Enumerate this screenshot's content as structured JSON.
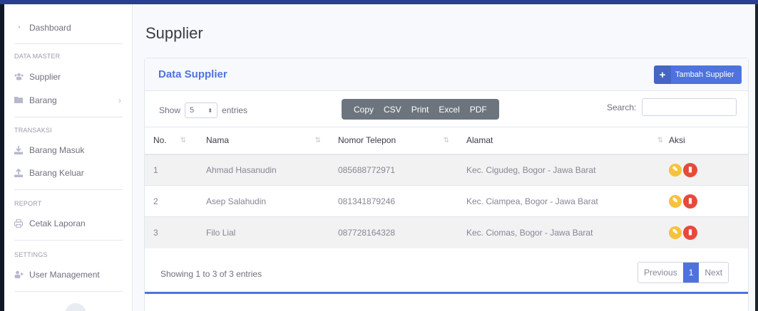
{
  "sidebar": {
    "dashboard": "Dashboard",
    "heading_master": "DATA MASTER",
    "supplier": "Supplier",
    "barang": "Barang",
    "heading_transaksi": "TRANSAKSI",
    "barang_masuk": "Barang Masuk",
    "barang_keluar": "Barang Keluar",
    "heading_report": "REPORT",
    "cetak_laporan": "Cetak Laporan",
    "heading_settings": "SETTINGS",
    "user_management": "User Management"
  },
  "page": {
    "title": "Supplier"
  },
  "card": {
    "title": "Data Supplier",
    "add_button": "Tambah Supplier"
  },
  "table_controls": {
    "show_label": "Show",
    "entries_value": "5",
    "entries_label": "entries",
    "buttons": [
      "Copy",
      "CSV",
      "Print",
      "Excel",
      "PDF"
    ],
    "search_label": "Search:",
    "search_value": ""
  },
  "table": {
    "headers": [
      "No.",
      "Nama",
      "Nomor Telepon",
      "Alamat",
      "Aksi"
    ],
    "rows": [
      {
        "no": "1",
        "nama": "Ahmad Hasanudin",
        "telepon": "085688772971",
        "alamat": "Kec. Cigudeg, Bogor - Jawa Barat"
      },
      {
        "no": "2",
        "nama": "Asep Salahudin",
        "telepon": "081341879246",
        "alamat": "Kec. Ciampea, Bogor - Jawa Barat"
      },
      {
        "no": "3",
        "nama": "Filo Lial",
        "telepon": "087728164328",
        "alamat": "Kec. Ciomas, Bogor - Jawa Barat"
      }
    ]
  },
  "footer": {
    "info": "Showing 1 to 3 of 3 entries",
    "previous": "Previous",
    "current_page": "1",
    "next": "Next"
  },
  "colors": {
    "primary": "#4e73df",
    "edit": "#f6c23e",
    "delete": "#e74a3b",
    "button_group": "#6c757d"
  },
  "icons": {
    "dashboard": "dashboard-icon",
    "supplier": "users-icon",
    "barang": "folder-icon",
    "barang_masuk": "download-icon",
    "barang_keluar": "upload-icon",
    "cetak_laporan": "print-icon",
    "user_management": "user-plus-icon",
    "edit": "edit-icon",
    "delete": "trash-icon"
  }
}
